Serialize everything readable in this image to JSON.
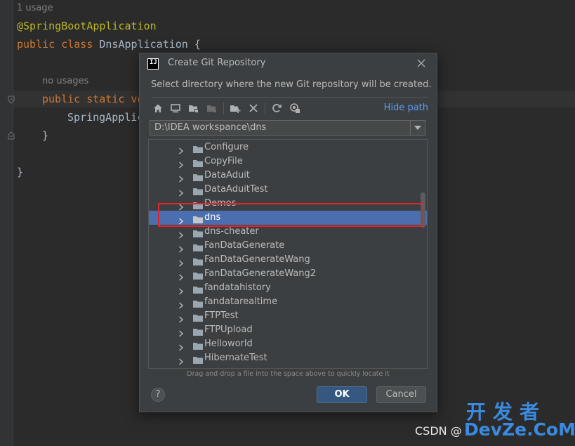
{
  "editor": {
    "hint_usage": "1 usage",
    "annotation": "@SpringBootApplication",
    "class_kw": "public class",
    "class_name": " DnsApplication {",
    "hint_no_usages": "no usages",
    "method_kw": "public static vo",
    "call": "SpringApplic",
    "close_brace_inner": "}",
    "close_brace_outer": "}"
  },
  "dialog": {
    "title": "Create Git Repository",
    "description": "Select directory where the new Git repository will be created.",
    "hide_path": "Hide path",
    "path_value": "D:\\IDEA workspance\\dns",
    "drag_hint": "Drag and drop a file into the space above to quickly locate it",
    "help": "?",
    "ok": "OK",
    "cancel": "Cancel",
    "app_logo_text": "IJ",
    "toolbar_icons": [
      "home-icon",
      "desktop-icon",
      "project-folder-icon",
      "module-folder-icon",
      "new-folder-icon",
      "delete-icon",
      "refresh-icon",
      "show-hidden-icon"
    ],
    "tree_items": [
      {
        "label": "Configure",
        "selected": false
      },
      {
        "label": "CopyFile",
        "selected": false
      },
      {
        "label": "DataAduit",
        "selected": false
      },
      {
        "label": "DataAduitTest",
        "selected": false
      },
      {
        "label": "Demos",
        "selected": false
      },
      {
        "label": "dns",
        "selected": true
      },
      {
        "label": "dns-cheater",
        "selected": false
      },
      {
        "label": "FanDataGenerate",
        "selected": false
      },
      {
        "label": "FanDataGenerateWang",
        "selected": false
      },
      {
        "label": "FanDataGenerateWang2",
        "selected": false
      },
      {
        "label": "fandatahistory",
        "selected": false
      },
      {
        "label": "fandatarealtime",
        "selected": false
      },
      {
        "label": "FTPTest",
        "selected": false
      },
      {
        "label": "FTPUpload",
        "selected": false
      },
      {
        "label": "Helloworld",
        "selected": false
      },
      {
        "label": "HibernateTest",
        "selected": false
      }
    ]
  },
  "watermark": {
    "csdn": "CSDN @",
    "big": "开发者",
    "site": "DevZe.CoM"
  },
  "colors": {
    "editor_bg": "#2b2b2b",
    "dialog_bg": "#3c3f41",
    "selection": "#4b6eaf",
    "link": "#589df6",
    "highlight_box": "#e0262d",
    "ok_button": "#365880"
  }
}
